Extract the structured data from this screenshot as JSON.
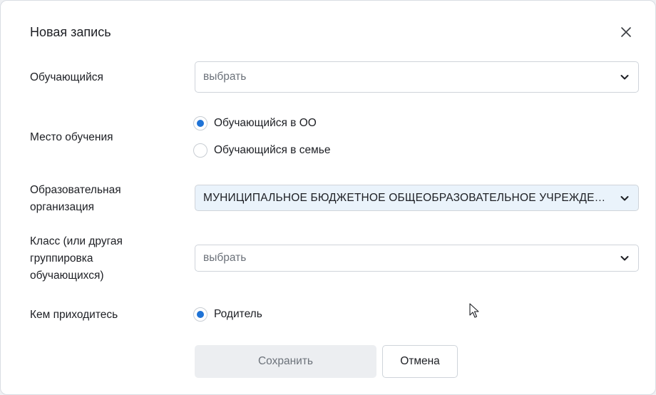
{
  "dialog": {
    "title": "Новая запись",
    "close_icon": "close-icon"
  },
  "form": {
    "student": {
      "label": "Обучающийся",
      "placeholder": "выбрать"
    },
    "place": {
      "label": "Место обучения",
      "options": [
        {
          "label": "Обучающийся в ОО",
          "selected": true
        },
        {
          "label": "Обучающийся в семье",
          "selected": false
        }
      ]
    },
    "organization": {
      "label_line1": "Образовательная",
      "label_line2": "организация",
      "value": "МУНИЦИПАЛЬНОЕ БЮДЖЕТНОЕ ОБЩЕОБРАЗОВАТЕЛЬНОЕ УЧРЕЖДЕНИЕ"
    },
    "class": {
      "label_line1": "Класс (или другая",
      "label_line2": "группировка",
      "label_line3": "обучающихся)",
      "placeholder": "выбрать"
    },
    "relation": {
      "label": "Кем приходитесь",
      "option": {
        "label": "Родитель",
        "selected": true
      }
    }
  },
  "actions": {
    "save_label": "Сохранить",
    "cancel_label": "Отмена"
  },
  "colors": {
    "accent": "#1f73d6",
    "filled_select_bg": "#eaf3fb",
    "disabled_button_bg": "#eceef1"
  }
}
